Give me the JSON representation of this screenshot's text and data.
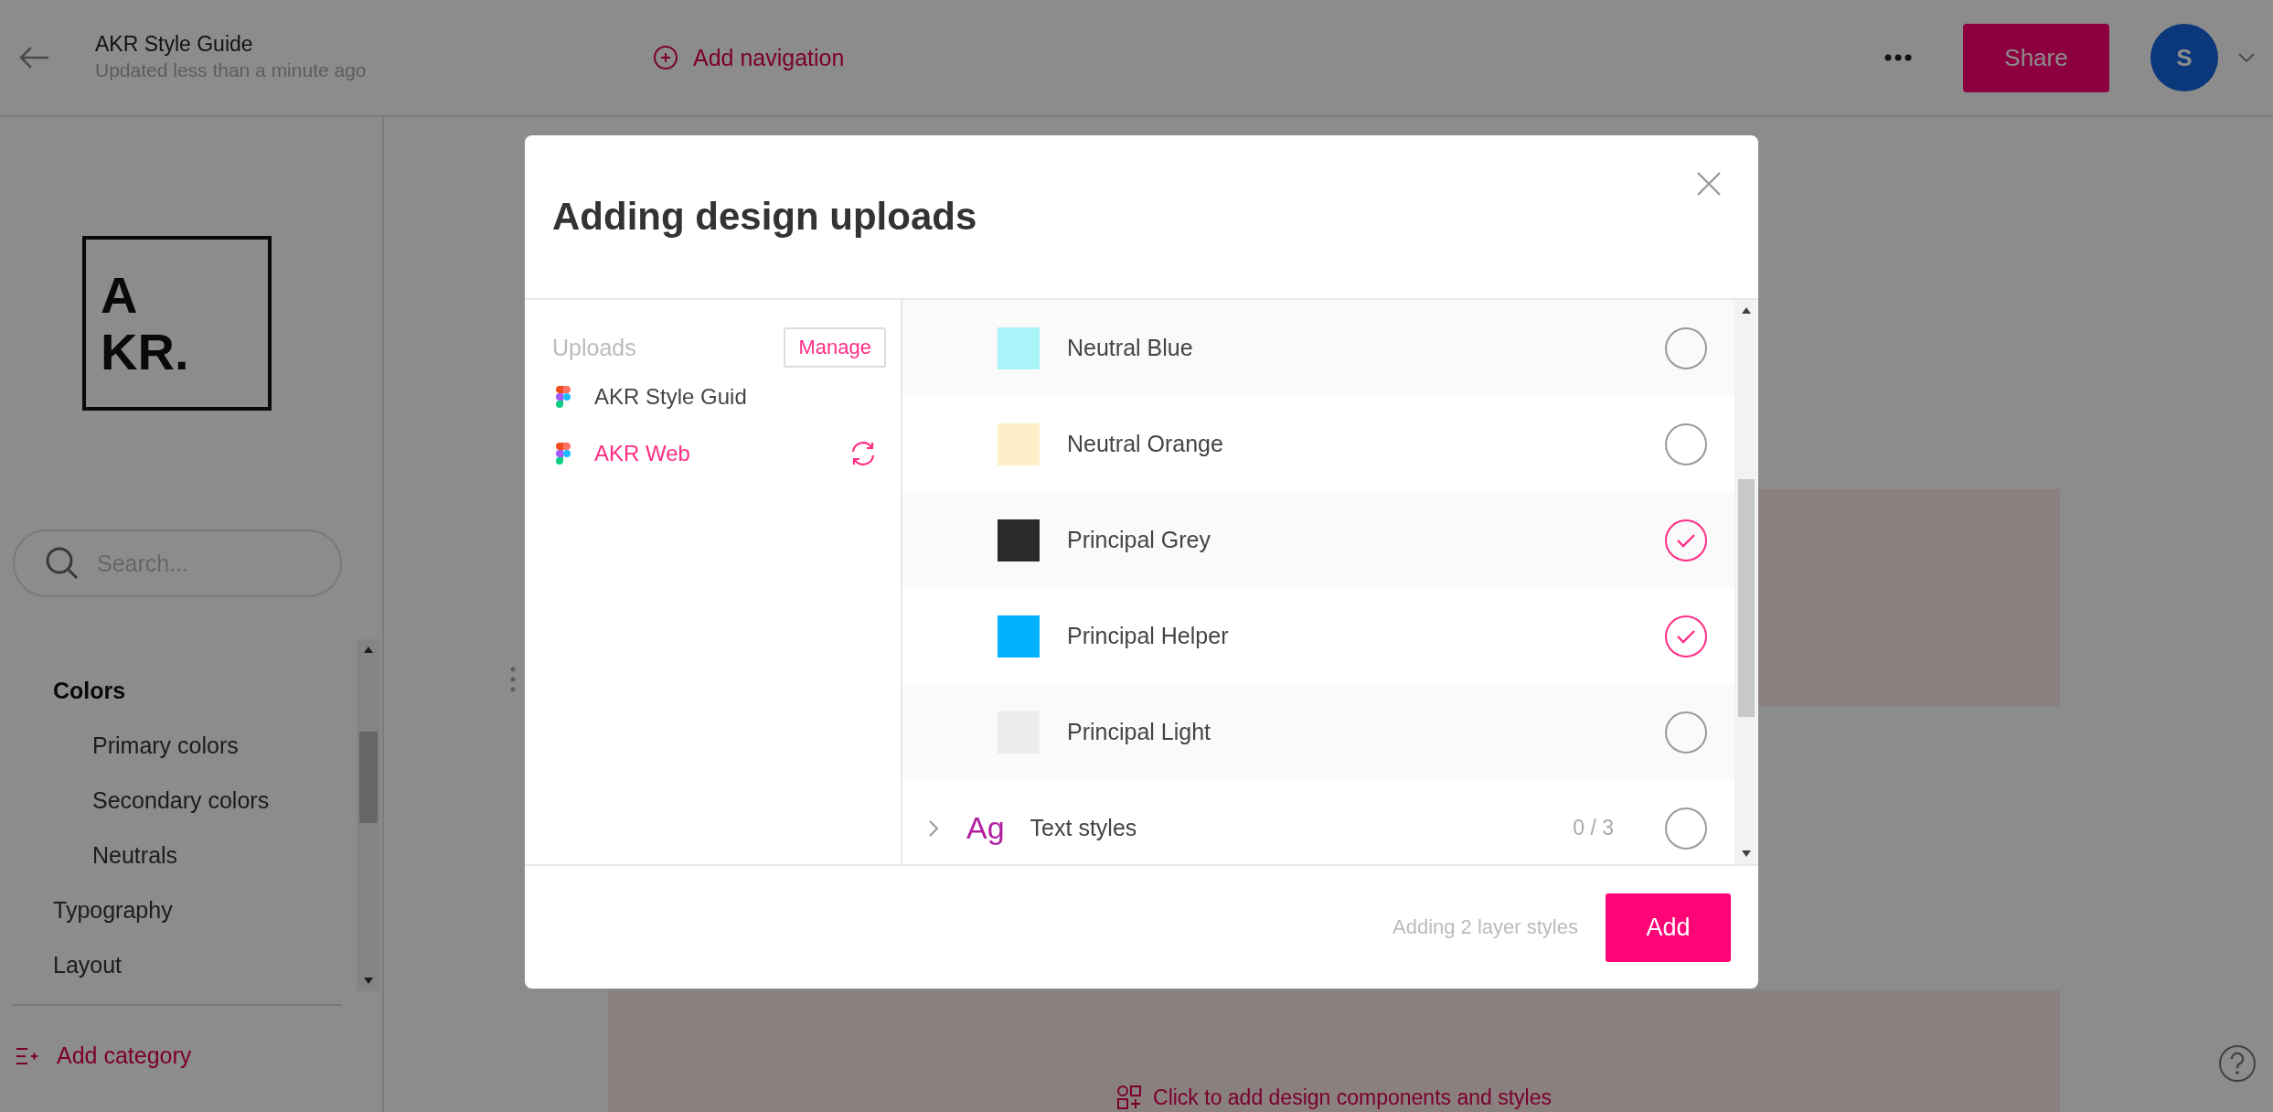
{
  "header": {
    "title": "AKR Style Guide",
    "subtitle": "Updated less than a minute ago",
    "add_navigation": "Add navigation",
    "share": "Share",
    "avatar": "S"
  },
  "sidebar": {
    "logo": [
      "A",
      "KR."
    ],
    "search": {
      "placeholder": "Search..."
    },
    "items": [
      {
        "label": "Colors",
        "selected": true,
        "children": [
          {
            "label": "Primary colors",
            "selected": false
          },
          {
            "label": "Secondary colors",
            "selected": false
          },
          {
            "label": "Neutrals",
            "selected": false
          }
        ]
      },
      {
        "label": "Typography",
        "selected": false
      },
      {
        "label": "Layout",
        "selected": false
      }
    ],
    "add_category": "Add category"
  },
  "main": {
    "add_components": "Click to add design components and styles"
  },
  "modal": {
    "title": "Adding design uploads",
    "uploads_label": "Uploads",
    "manage": "Manage",
    "uploads": [
      {
        "name": "AKR Style Guid",
        "selected": false,
        "syncing": false
      },
      {
        "name": "AKR Web",
        "selected": true,
        "syncing": true
      }
    ],
    "rows": [
      {
        "kind": "color",
        "name": "Neutral Blue",
        "color": "#a8f4f8",
        "checked": false
      },
      {
        "kind": "color",
        "name": "Neutral Orange",
        "color": "#fdf0c8",
        "checked": false
      },
      {
        "kind": "color",
        "name": "Principal Grey",
        "color": "#2a2a2a",
        "checked": true
      },
      {
        "kind": "color",
        "name": "Principal Helper",
        "color": "#00b2ff",
        "checked": true
      },
      {
        "kind": "color",
        "name": "Principal Light",
        "color": "#ececec",
        "checked": false
      },
      {
        "kind": "group",
        "icon": "Ag",
        "name": "Text styles",
        "count": "0 / 3",
        "expanded": false,
        "checked": false
      }
    ],
    "status": "Adding 2 layer styles",
    "add": "Add"
  }
}
